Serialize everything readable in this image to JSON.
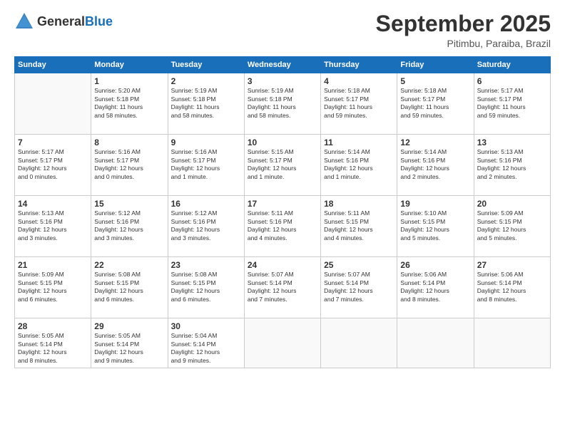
{
  "header": {
    "logo": {
      "general": "General",
      "blue": "Blue"
    },
    "title": "September 2025",
    "location": "Pitimbu, Paraiba, Brazil"
  },
  "weekdays": [
    "Sunday",
    "Monday",
    "Tuesday",
    "Wednesday",
    "Thursday",
    "Friday",
    "Saturday"
  ],
  "weeks": [
    [
      {
        "day": "",
        "info": ""
      },
      {
        "day": "1",
        "info": "Sunrise: 5:20 AM\nSunset: 5:18 PM\nDaylight: 11 hours\nand 58 minutes."
      },
      {
        "day": "2",
        "info": "Sunrise: 5:19 AM\nSunset: 5:18 PM\nDaylight: 11 hours\nand 58 minutes."
      },
      {
        "day": "3",
        "info": "Sunrise: 5:19 AM\nSunset: 5:18 PM\nDaylight: 11 hours\nand 58 minutes."
      },
      {
        "day": "4",
        "info": "Sunrise: 5:18 AM\nSunset: 5:17 PM\nDaylight: 11 hours\nand 59 minutes."
      },
      {
        "day": "5",
        "info": "Sunrise: 5:18 AM\nSunset: 5:17 PM\nDaylight: 11 hours\nand 59 minutes."
      },
      {
        "day": "6",
        "info": "Sunrise: 5:17 AM\nSunset: 5:17 PM\nDaylight: 11 hours\nand 59 minutes."
      }
    ],
    [
      {
        "day": "7",
        "info": "Sunrise: 5:17 AM\nSunset: 5:17 PM\nDaylight: 12 hours\nand 0 minutes."
      },
      {
        "day": "8",
        "info": "Sunrise: 5:16 AM\nSunset: 5:17 PM\nDaylight: 12 hours\nand 0 minutes."
      },
      {
        "day": "9",
        "info": "Sunrise: 5:16 AM\nSunset: 5:17 PM\nDaylight: 12 hours\nand 1 minute."
      },
      {
        "day": "10",
        "info": "Sunrise: 5:15 AM\nSunset: 5:17 PM\nDaylight: 12 hours\nand 1 minute."
      },
      {
        "day": "11",
        "info": "Sunrise: 5:14 AM\nSunset: 5:16 PM\nDaylight: 12 hours\nand 1 minute."
      },
      {
        "day": "12",
        "info": "Sunrise: 5:14 AM\nSunset: 5:16 PM\nDaylight: 12 hours\nand 2 minutes."
      },
      {
        "day": "13",
        "info": "Sunrise: 5:13 AM\nSunset: 5:16 PM\nDaylight: 12 hours\nand 2 minutes."
      }
    ],
    [
      {
        "day": "14",
        "info": "Sunrise: 5:13 AM\nSunset: 5:16 PM\nDaylight: 12 hours\nand 3 minutes."
      },
      {
        "day": "15",
        "info": "Sunrise: 5:12 AM\nSunset: 5:16 PM\nDaylight: 12 hours\nand 3 minutes."
      },
      {
        "day": "16",
        "info": "Sunrise: 5:12 AM\nSunset: 5:16 PM\nDaylight: 12 hours\nand 3 minutes."
      },
      {
        "day": "17",
        "info": "Sunrise: 5:11 AM\nSunset: 5:16 PM\nDaylight: 12 hours\nand 4 minutes."
      },
      {
        "day": "18",
        "info": "Sunrise: 5:11 AM\nSunset: 5:15 PM\nDaylight: 12 hours\nand 4 minutes."
      },
      {
        "day": "19",
        "info": "Sunrise: 5:10 AM\nSunset: 5:15 PM\nDaylight: 12 hours\nand 5 minutes."
      },
      {
        "day": "20",
        "info": "Sunrise: 5:09 AM\nSunset: 5:15 PM\nDaylight: 12 hours\nand 5 minutes."
      }
    ],
    [
      {
        "day": "21",
        "info": "Sunrise: 5:09 AM\nSunset: 5:15 PM\nDaylight: 12 hours\nand 6 minutes."
      },
      {
        "day": "22",
        "info": "Sunrise: 5:08 AM\nSunset: 5:15 PM\nDaylight: 12 hours\nand 6 minutes."
      },
      {
        "day": "23",
        "info": "Sunrise: 5:08 AM\nSunset: 5:15 PM\nDaylight: 12 hours\nand 6 minutes."
      },
      {
        "day": "24",
        "info": "Sunrise: 5:07 AM\nSunset: 5:14 PM\nDaylight: 12 hours\nand 7 minutes."
      },
      {
        "day": "25",
        "info": "Sunrise: 5:07 AM\nSunset: 5:14 PM\nDaylight: 12 hours\nand 7 minutes."
      },
      {
        "day": "26",
        "info": "Sunrise: 5:06 AM\nSunset: 5:14 PM\nDaylight: 12 hours\nand 8 minutes."
      },
      {
        "day": "27",
        "info": "Sunrise: 5:06 AM\nSunset: 5:14 PM\nDaylight: 12 hours\nand 8 minutes."
      }
    ],
    [
      {
        "day": "28",
        "info": "Sunrise: 5:05 AM\nSunset: 5:14 PM\nDaylight: 12 hours\nand 8 minutes."
      },
      {
        "day": "29",
        "info": "Sunrise: 5:05 AM\nSunset: 5:14 PM\nDaylight: 12 hours\nand 9 minutes."
      },
      {
        "day": "30",
        "info": "Sunrise: 5:04 AM\nSunset: 5:14 PM\nDaylight: 12 hours\nand 9 minutes."
      },
      {
        "day": "",
        "info": ""
      },
      {
        "day": "",
        "info": ""
      },
      {
        "day": "",
        "info": ""
      },
      {
        "day": "",
        "info": ""
      }
    ]
  ]
}
